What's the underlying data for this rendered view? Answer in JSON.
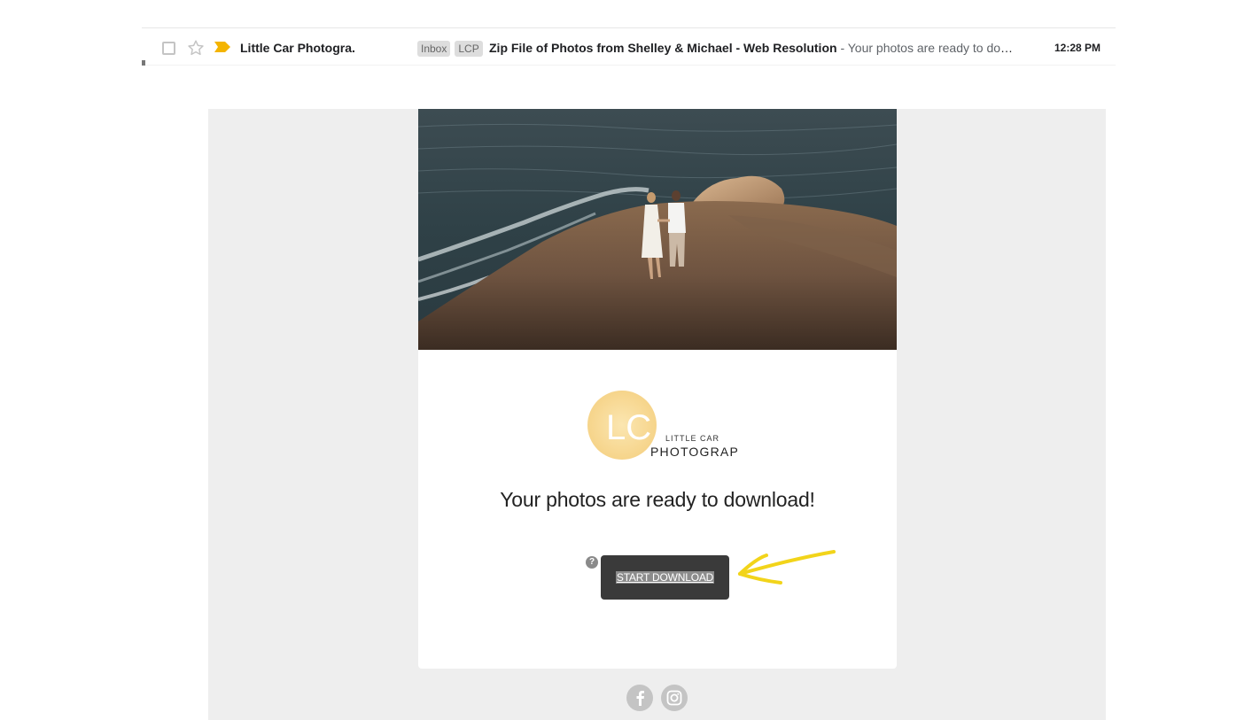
{
  "inbox_row": {
    "sender": "Little Car Photogra.",
    "labels": [
      "Inbox",
      "LCP"
    ],
    "subject": "Zip File of Photos from Shelley & Michael - Web Resolution",
    "snippet": " - Your photos are ready to dow…",
    "time": "12:28 PM",
    "importance_color": "#f4b400"
  },
  "email": {
    "logo_text": {
      "initials": "LC",
      "line1": "LITTLE CAR",
      "line2": "PHOTOGRAPHY"
    },
    "headline": "Your photos are ready to download!",
    "help_glyph": "?",
    "download_label": "START DOWNLOAD",
    "annotation_color": "#f2d41a",
    "social": [
      {
        "name": "facebook-icon",
        "glyph": "f"
      },
      {
        "name": "instagram-icon",
        "glyph": ""
      }
    ]
  },
  "colors": {
    "canvas_bg": "#eeeeee",
    "button_bg": "#3a3a3a",
    "social_bg": "#c4c4c4"
  }
}
